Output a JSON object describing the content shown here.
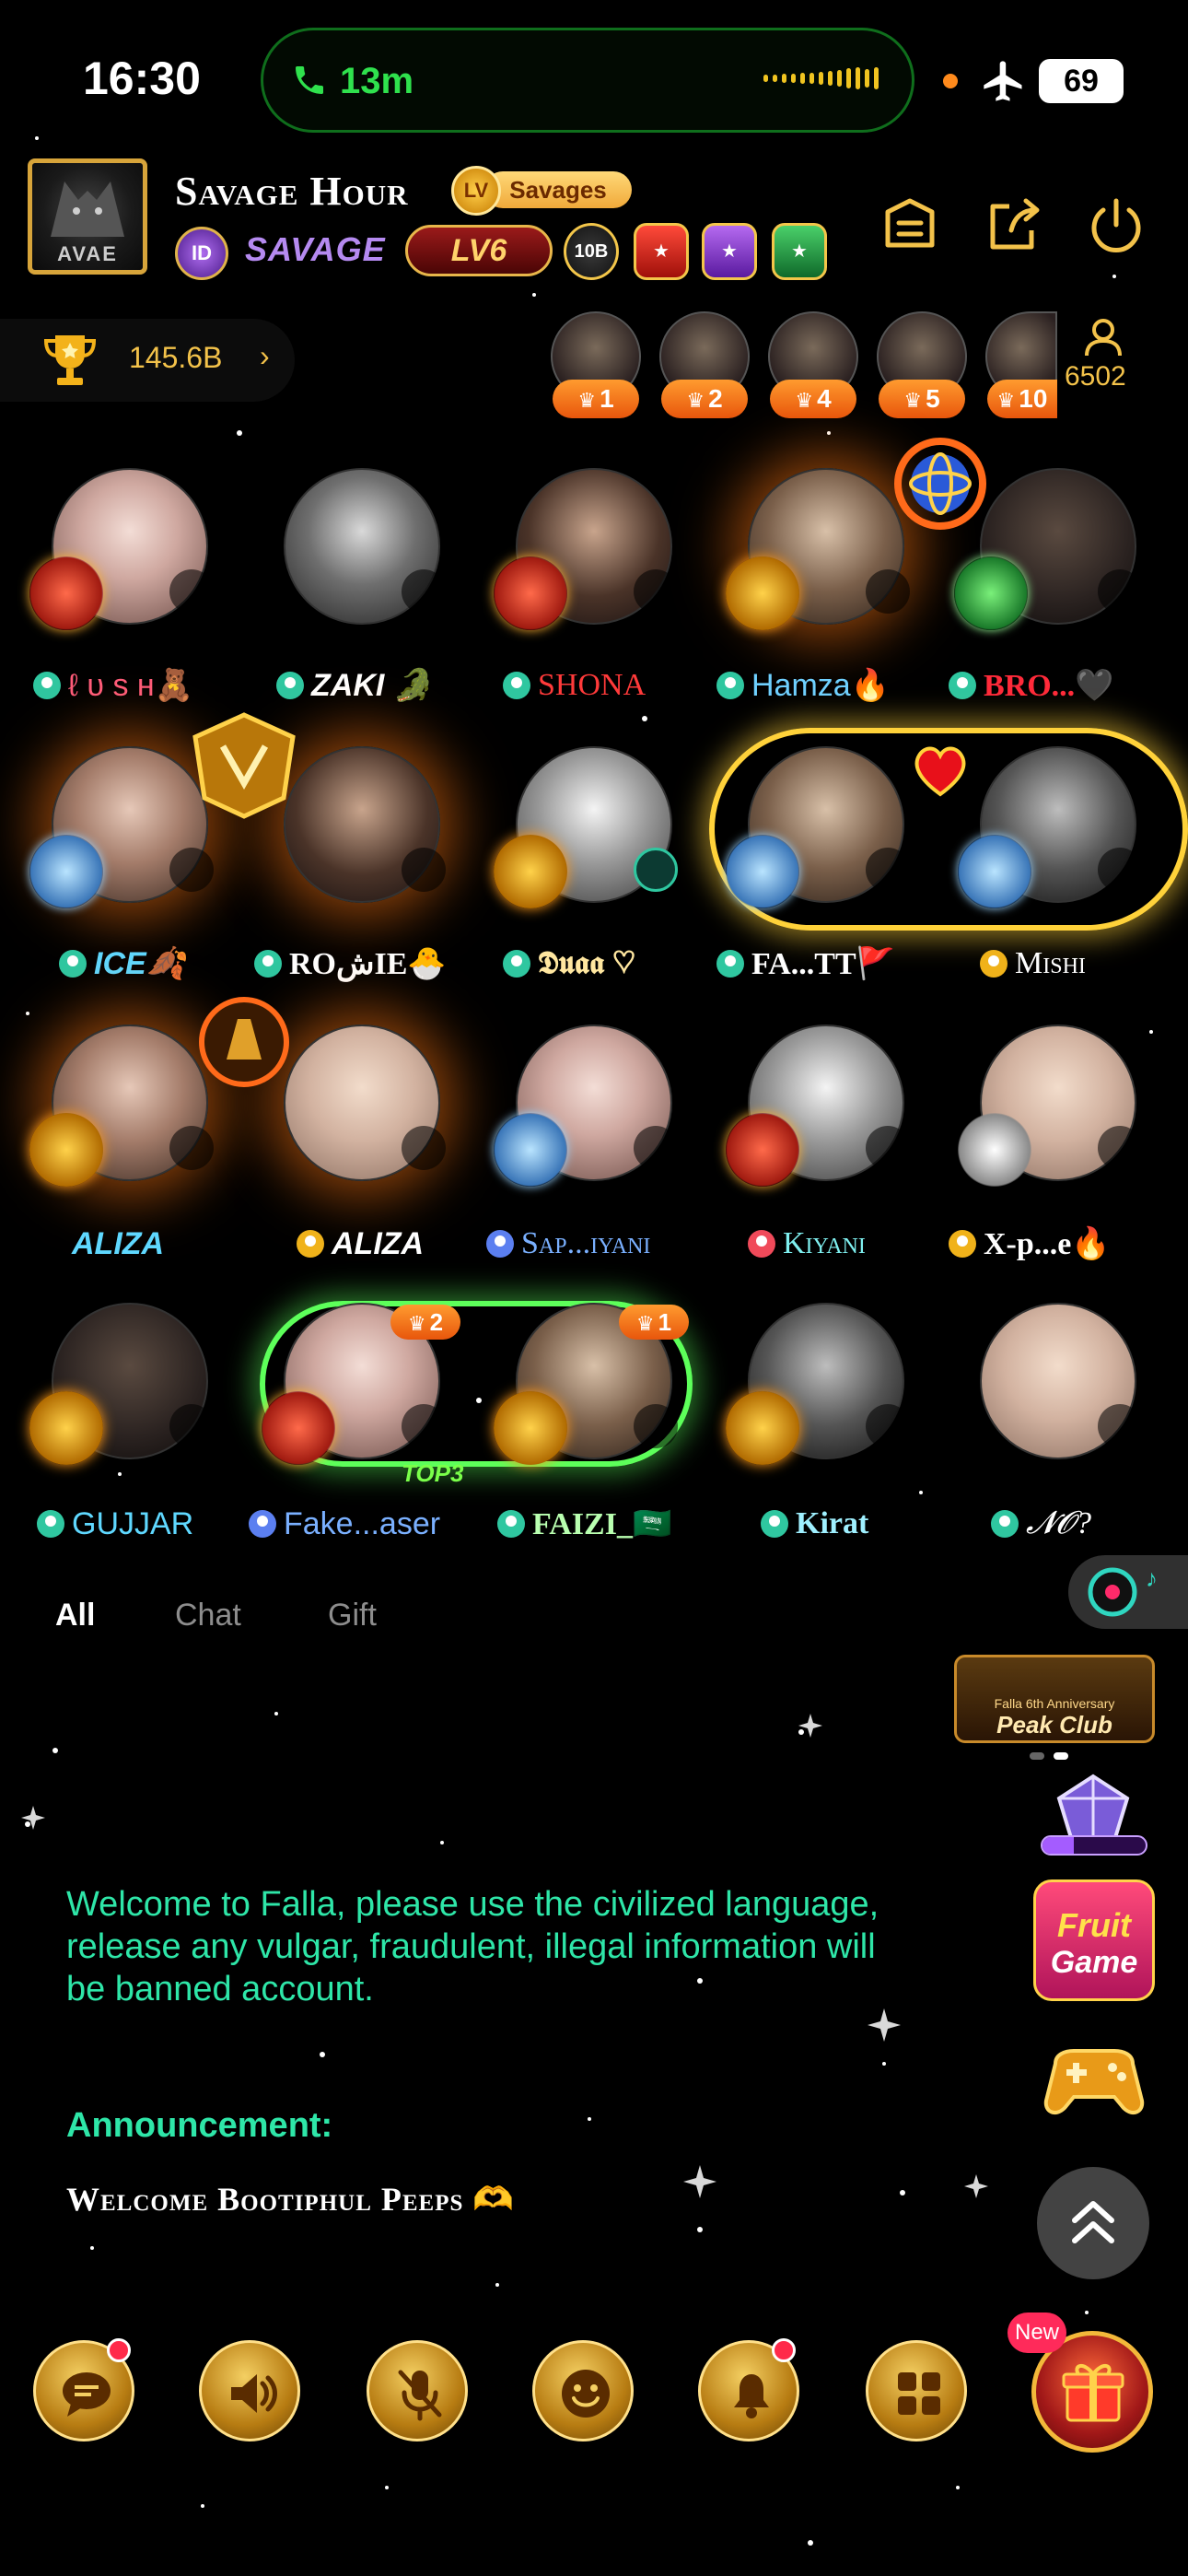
{
  "status_bar": {
    "time": "16:30",
    "call_duration": "13m",
    "battery": "69"
  },
  "room": {
    "title": "Savage Hour",
    "family_badge": "Savages",
    "family_badge_level": "LV",
    "id_badge": "ID",
    "owner_tag": "SAVAGE",
    "level": "LV6",
    "badge_rank": "10B"
  },
  "header_actions": {
    "menu": "menu-icon",
    "share": "share-icon",
    "exit": "power-icon"
  },
  "trophy": {
    "value": "145.6B",
    "arrow": "›"
  },
  "top_fans": [
    {
      "rank": "1"
    },
    {
      "rank": "2"
    },
    {
      "rank": "4"
    },
    {
      "rank": "5"
    },
    {
      "rank": "10"
    }
  ],
  "viewers": "6502",
  "seats": [
    {
      "name": "ℓ υ ѕ н🧸",
      "name_color": "#ff5c7a"
    },
    {
      "name": "ZAKI 🐊",
      "name_color": "#ffffff"
    },
    {
      "name": "SHONA",
      "name_color": "#ff3a3a"
    },
    {
      "name": "Hamza🔥",
      "name_color": "#6fd0ff"
    },
    {
      "name": "BRO...🖤",
      "name_color": "#ff2a3a"
    },
    {
      "name": "ICE🍂",
      "name_color": "#5fd8ff"
    },
    {
      "name": "ROشIE🐣",
      "name_color": "#ffffff"
    },
    {
      "name": "𝕯𝖚𝖆𝖆 ♡",
      "name_color": "#ffe7a0"
    },
    {
      "name": "FA...TT🚩",
      "name_color": "#ffffff"
    },
    {
      "name": "Mishi",
      "name_color": "#ffffff"
    },
    {
      "name": "ALIZA",
      "name_color": "#5fd8ff"
    },
    {
      "name": "ALIZA",
      "name_color": "#ffffff"
    },
    {
      "name": "Sap...iyani",
      "name_color": "#7ab0ff"
    },
    {
      "name": "Kiyani",
      "name_color": "#7ff0f0"
    },
    {
      "name": "X-p...e🔥",
      "name_color": "#ffffff"
    },
    {
      "name": "GUJJAR",
      "name_color": "#5fd8ff"
    },
    {
      "name": "Fake...aser",
      "name_color": "#7ab0ff"
    },
    {
      "name": "FAIZI_🇸🇦",
      "name_color": "#b9ffb0"
    },
    {
      "name": "Kirat",
      "name_color": "#9ff0ff"
    },
    {
      "name": "𝓝𝓞?",
      "name_color": "#ffffff"
    }
  ],
  "couple_badges": {
    "left": "2",
    "right": "1",
    "label": "TOP3"
  },
  "tabs": [
    {
      "label": "All",
      "active": true
    },
    {
      "label": "Chat",
      "active": false
    },
    {
      "label": "Gift",
      "active": false
    }
  ],
  "chat": {
    "welcome": "Welcome to Falla, please use the civilized language, release any vulgar, fraudulent, illegal information will be banned account.",
    "announcement_title": "Announcement:",
    "announcement_body": "Welcome Bootiphul Peeps 🫶"
  },
  "right_rail": {
    "banner_small": "Falla 6th Anniversary",
    "banner_title": "Peak Club",
    "game_line1": "Fruit",
    "game_line2": "Game"
  },
  "bottom_bar": {
    "new_label": "New",
    "icons": [
      "chat-icon",
      "speaker-icon",
      "mic-muted-icon",
      "emoji-icon",
      "bell-icon",
      "apps-icon",
      "gift-icon"
    ]
  }
}
